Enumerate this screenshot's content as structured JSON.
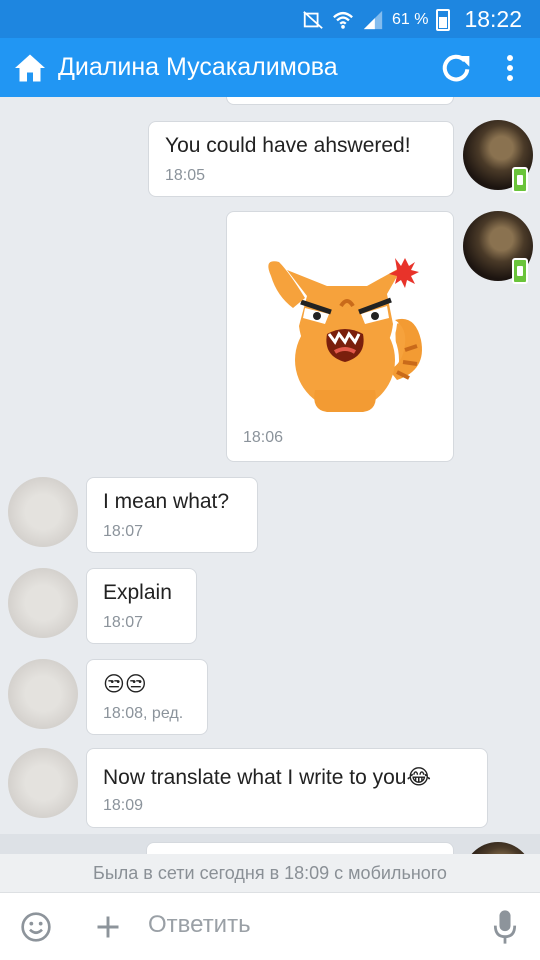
{
  "status_bar": {
    "battery": "61 %",
    "time": "18:22"
  },
  "toolbar": {
    "title": "Диалина Мусакалимова"
  },
  "messages": [
    {
      "text": "You could have ahswered!",
      "time": "18:05"
    },
    {
      "time": "18:06"
    },
    {
      "text": "I mean what?",
      "time": "18:07"
    },
    {
      "text": "Explain",
      "time": "18:07"
    },
    {
      "text": "😒😒",
      "time": "18:08, ред."
    },
    {
      "text": "Now translate what I write to you😂",
      "time": "18:09"
    }
  ],
  "last_seen": "Была в сети сегодня в 18:09 с мобильного",
  "input": {
    "placeholder": "Ответить"
  },
  "colors": {
    "statusbar": "#1e86e0",
    "toolbar": "#2196f3",
    "background": "#e8ebef",
    "online_badge": "#6ac43a"
  }
}
